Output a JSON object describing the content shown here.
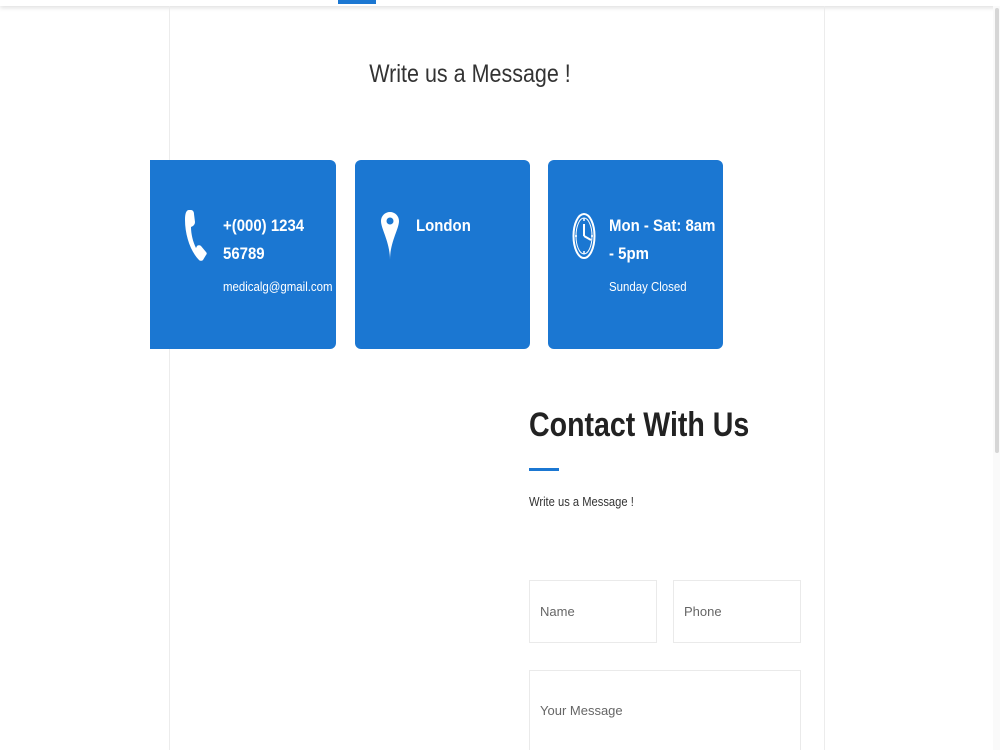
{
  "section": {
    "heading": "Write us a Message !"
  },
  "cards": {
    "phone": {
      "icon": "phone-icon",
      "title_line1": "+(000) 1234",
      "title_line2": "56789",
      "subtitle": "medicalg@gmail.com"
    },
    "location": {
      "icon": "map-pin-icon",
      "title_line1": "London"
    },
    "hours": {
      "icon": "clock-icon",
      "title_line1": "Mon - Sat: 8am",
      "title_line2": "- 5pm",
      "subtitle": "Sunday Closed"
    }
  },
  "contact": {
    "title": "Contact With Us",
    "subtitle": "Write us a Message !",
    "name_placeholder": "Name",
    "phone_placeholder": "Phone",
    "message_placeholder": "Your Message"
  },
  "colors": {
    "accent": "#1b77d2",
    "card_text": "#ffffff",
    "heading_text": "#222222"
  }
}
